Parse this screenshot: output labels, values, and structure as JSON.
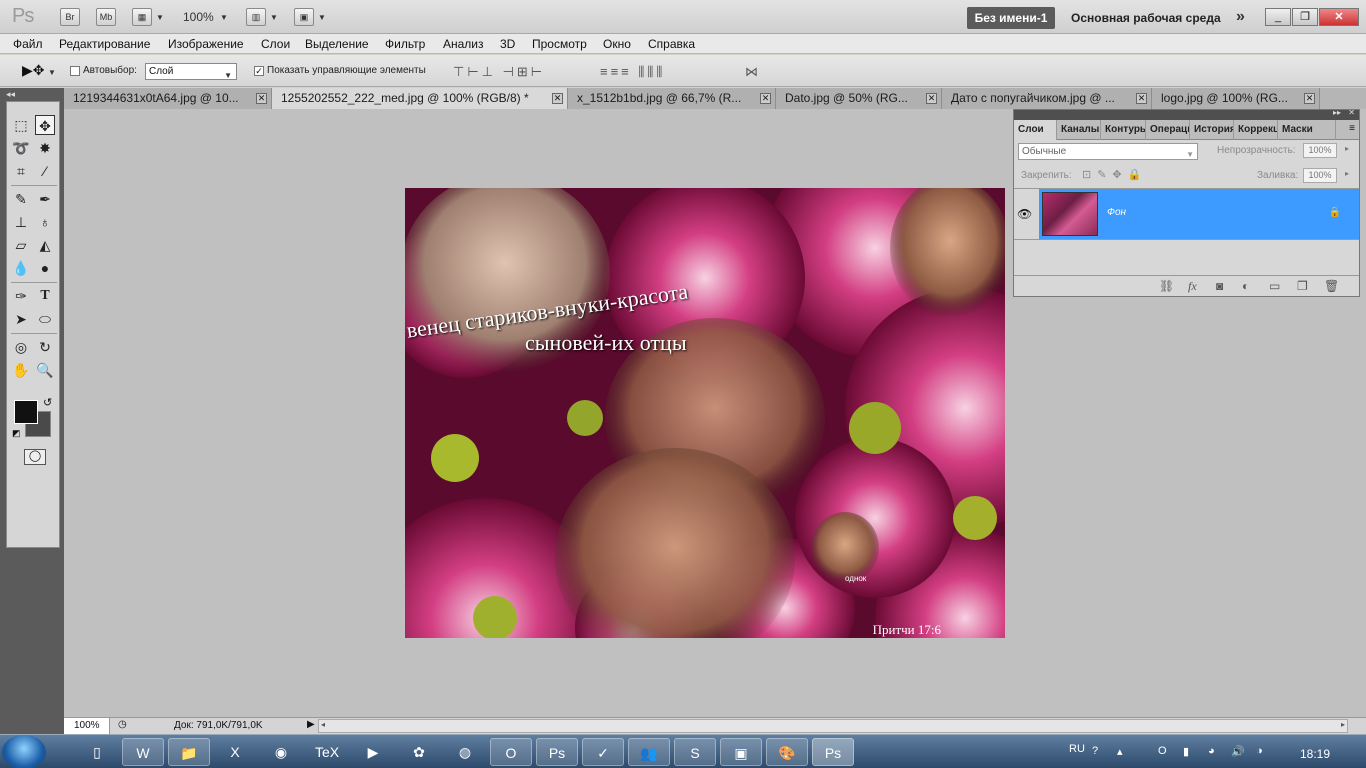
{
  "app": {
    "logo": "Ps",
    "bridge": "Br",
    "mini_bridge": "Mb",
    "zoom": "100%",
    "document_title": "Без имени-1",
    "workspace": "Основная рабочая среда"
  },
  "menu": [
    "Файл",
    "Редактирование",
    "Изображение",
    "Слои",
    "Выделение",
    "Фильтр",
    "Анализ",
    "3D",
    "Просмотр",
    "Окно",
    "Справка"
  ],
  "options": {
    "auto_select_label": "Автовыбор:",
    "auto_select_checked": false,
    "auto_select_target": "Слой",
    "show_controls_label": "Показать управляющие элементы",
    "show_controls_checked": true
  },
  "doc_tabs": [
    {
      "label": "1219344631x0tA64.jpg @ 10...",
      "active": false
    },
    {
      "label": "1255202552_222_med.jpg @ 100% (RGB/8) *",
      "active": true
    },
    {
      "label": "x_1512b1bd.jpg @ 66,7% (R...",
      "active": false
    },
    {
      "label": "Dato.jpg @ 50% (RG...",
      "active": false
    },
    {
      "label": "Дато с попугайчиком.jpg @ ...",
      "active": false
    },
    {
      "label": "logo.jpg @ 100% (RG...",
      "active": false
    }
  ],
  "artwork": {
    "caption_line1": "венец стариков-внуки-красота",
    "caption_line2": "сыновей-их отцы",
    "source": "Притчи 17:6",
    "watermark": "однок"
  },
  "status": {
    "zoom": "100%",
    "doc_size": "Док: 791,0K/791,0K"
  },
  "layers_panel": {
    "tabs": [
      "Слои",
      "Каналы",
      "Контуры",
      "Операции",
      "История",
      "Коррекция",
      "Маски"
    ],
    "blend_mode": "Обычные",
    "opacity_label": "Непрозрачность:",
    "opacity": "100%",
    "lock_label": "Закрепить:",
    "fill_label": "Заливка:",
    "fill": "100%",
    "layers": [
      {
        "name": "Фон",
        "visible": true,
        "locked": true
      }
    ]
  },
  "taskbar": {
    "language": "RU",
    "time": "18:19"
  },
  "colors": {
    "accent_selection": "#3d9bff",
    "foreground": "#111111",
    "background": "#4a4a4a"
  }
}
